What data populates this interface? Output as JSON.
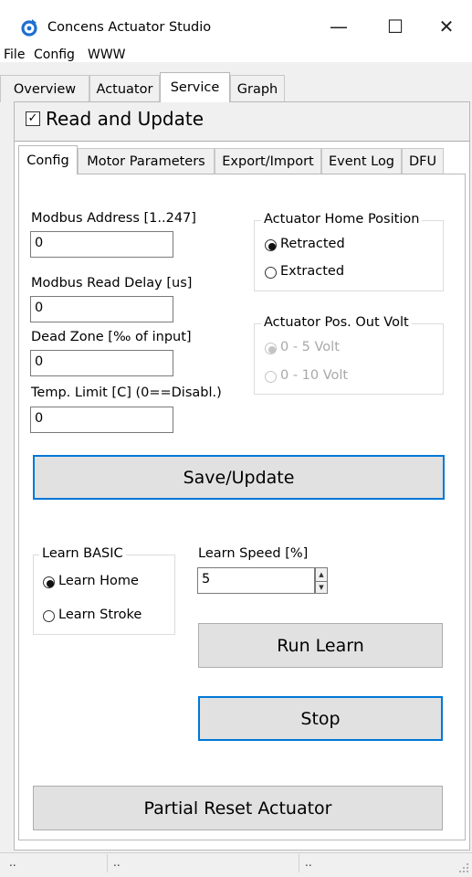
{
  "window": {
    "title": "Concens Actuator Studio",
    "controls": {
      "minimize": "—",
      "maximize": "☐",
      "close": "✕"
    }
  },
  "menu": [
    "File",
    "Config",
    "WWW"
  ],
  "outer_tabs": [
    "Overview",
    "Actuator",
    "Service",
    "Graph"
  ],
  "outer_tab_selected": "Service",
  "read_update": {
    "label": "Read and Update",
    "checked": true,
    "check_glyph": "✓"
  },
  "inner_tabs": [
    "Config",
    "Motor Parameters",
    "Export/Import",
    "Event Log",
    "DFU"
  ],
  "inner_tab_selected": "Config",
  "config": {
    "modbus_address": {
      "label": "Modbus Address [1..247]",
      "value": "0"
    },
    "modbus_read_delay": {
      "label": "Modbus Read Delay [us]",
      "value": "0"
    },
    "dead_zone": {
      "label": "Dead Zone [‰ of input]",
      "value": "0"
    },
    "temp_limit": {
      "label": "Temp. Limit [C] (0==Disabl.)",
      "value": "0"
    }
  },
  "home_position": {
    "title": "Actuator Home Position",
    "options": [
      "Retracted",
      "Extracted"
    ],
    "selected": "Retracted"
  },
  "pos_out_volt": {
    "title": "Actuator Pos. Out Volt",
    "options": [
      "0 - 5 Volt",
      "0 - 10 Volt"
    ],
    "selected": "0 - 5 Volt",
    "disabled": true
  },
  "save_update_label": "Save/Update",
  "learn_basic": {
    "title": "Learn BASIC",
    "options": [
      "Learn Home",
      "Learn Stroke"
    ],
    "selected": "Learn Home"
  },
  "learn_speed": {
    "label": "Learn Speed [%]",
    "value": "5",
    "up_glyph": "▲",
    "down_glyph": "▼"
  },
  "run_learn_label": "Run Learn",
  "stop_label": "Stop",
  "partial_reset_label": "Partial Reset Actuator",
  "status_bar": [
    "..",
    "..",
    ".."
  ],
  "colors": {
    "focus_border": "#0078d7",
    "button_bg": "#e1e1e1",
    "app_icon": "#1e6fd0"
  }
}
